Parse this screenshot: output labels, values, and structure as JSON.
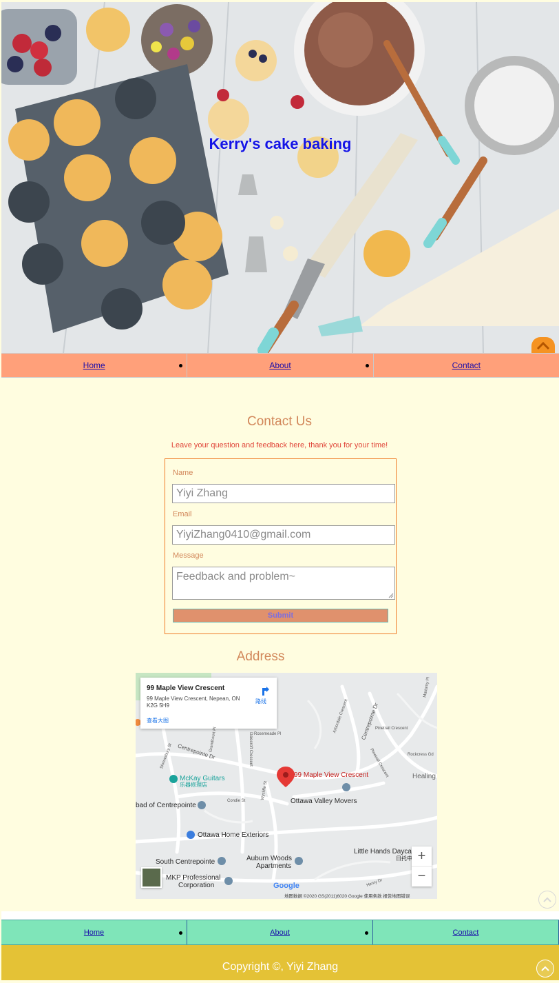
{
  "hero": {
    "title": "Kerry's cake baking"
  },
  "nav_top": {
    "items": [
      {
        "label": "Home"
      },
      {
        "label": "About"
      },
      {
        "label": "Contact"
      }
    ]
  },
  "contact": {
    "title": "Contact Us",
    "subtitle": "Leave your question and feedback here, thank you for your time!",
    "name_label": "Name",
    "name_value": "Yiyi Zhang",
    "email_label": "Email",
    "email_value": "YiyiZhang0410@gmail.com",
    "message_label": "Message",
    "message_placeholder": "Feedback and problem~",
    "submit_label": "Submit"
  },
  "address": {
    "title": "Address",
    "map": {
      "card_title": "99 Maple View Crescent",
      "card_address": "99 Maple View Crescent, Nepean, ON K2G 5H9",
      "card_link": "查看大图",
      "directions": "路线",
      "marker_label": "99 Maple View Crescent",
      "places": {
        "mckay": "McKay Guitars",
        "mckay_cn": "乐器修理店",
        "ottawa_valley": "Ottawa Valley Movers",
        "ottawa_home": "Ottawa Home Exteriors",
        "centrepointe_bad": "bad of Centrepointe",
        "south_centrepointe": "South Centrepointe",
        "auburn": "Auburn Woods",
        "auburn2": "Apartments",
        "mkp": "MKP Professional",
        "mkp2": "Corporation",
        "little_hands": "Little Hands Dayca",
        "little_hands2": "日托中",
        "healing": "Healing"
      },
      "streets": {
        "centrepointe_dr": "Centrepointe Dr",
        "rosemeade": "Rosemeade Pl",
        "pinetrail": "Pinetrail Crescent",
        "rockcress": "Rockcress Gd",
        "condie": "Condie St",
        "henry": "Henry Dr",
        "shrewsbury": "Shrewsbury St",
        "grandcourt": "Grandcourt Pl",
        "dalecroft": "Dalecroft Crescent",
        "wycliffe": "Wycliffe St",
        "arbordale": "Arbordale Crescent",
        "mattamy": "Mattamy Pl",
        "centrepointe_dr2": "Centrepointe Dr",
        "pinetrail2": "Pinetrail Crescent"
      },
      "zoom_in": "+",
      "zoom_out": "−",
      "google": "Google",
      "footer": "地图数据 ©2020 GS(2011)6020 Google   使用条款   报告地图错误"
    }
  },
  "nav_bottom": {
    "items": [
      {
        "label": "Home"
      },
      {
        "label": "About"
      },
      {
        "label": "Contact"
      }
    ]
  },
  "footer": {
    "copyright": "Copyright ©, Yiyi Zhang"
  },
  "colors": {
    "nav_top": "#ffa07a",
    "nav_bottom": "#7fe5b9",
    "footer": "#e4c236",
    "page_bg": "#fffde0",
    "title": "#1414e6",
    "accent": "#f59322"
  },
  "icons": {
    "back_to_top": "chevron-up-icon",
    "directions": "directions-icon",
    "map_pin": "map-pin-icon"
  }
}
